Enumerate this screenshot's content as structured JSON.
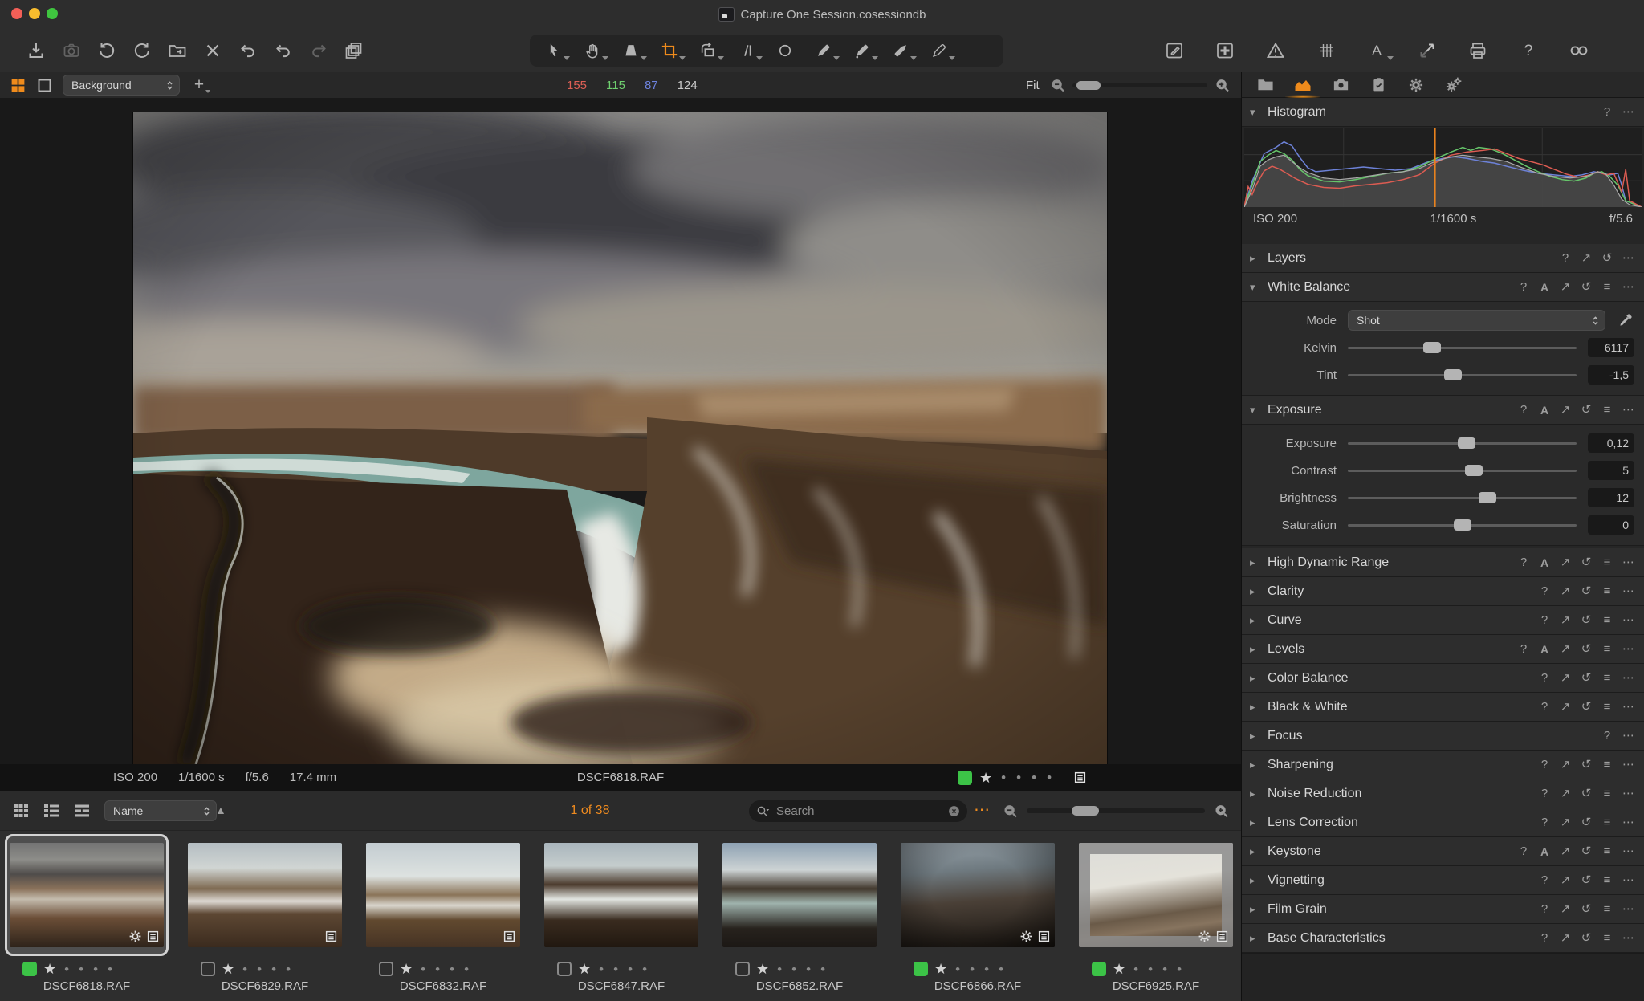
{
  "window": {
    "title": "Capture One Session.cosessiondb"
  },
  "toolbar": {
    "left": [
      {
        "name": "import-button",
        "icon": "import"
      },
      {
        "name": "capture-button",
        "icon": "camera",
        "dim": true,
        "gs": true
      },
      {
        "name": "rotate-ccw-button",
        "icon": "rotate-ccw",
        "gs": true
      },
      {
        "name": "rotate-cw-button",
        "icon": "rotate-cw"
      },
      {
        "name": "move-to-folder-button",
        "icon": "folder-move",
        "gs": true
      },
      {
        "name": "delete-button",
        "icon": "delete-x"
      },
      {
        "name": "revert-button",
        "icon": "undo",
        "gs": true
      },
      {
        "name": "undo-button",
        "icon": "undo",
        "gs": true
      },
      {
        "name": "redo-button",
        "icon": "redo",
        "dim": true
      },
      {
        "name": "clone-variant-button",
        "icon": "stack",
        "gs": true
      }
    ],
    "cursor_tools": [
      {
        "name": "select-tool",
        "icon": "select",
        "caret": true
      },
      {
        "name": "pan-tool",
        "icon": "hand",
        "caret": true
      },
      {
        "name": "loupe-tool",
        "icon": "loupe",
        "caret": true
      },
      {
        "name": "crop-tool",
        "icon": "crop",
        "caret": true,
        "active": true
      },
      {
        "name": "rotation-tool",
        "icon": "rotation",
        "caret": true
      },
      {
        "name": "straighten-tool",
        "icon": "straighten",
        "caret": true
      },
      {
        "name": "spot-tool",
        "icon": "spot"
      },
      {
        "name": "heal-brush-tool",
        "icon": "pen-draw",
        "caret": true
      },
      {
        "name": "clone-brush-tool",
        "icon": "pen-fill",
        "caret": true
      },
      {
        "name": "erase-brush-tool",
        "icon": "pen-erase",
        "caret": true
      },
      {
        "name": "color-picker-tool",
        "icon": "pen-pick",
        "caret": true
      }
    ],
    "right": [
      {
        "name": "edit-recipe-button",
        "icon": "edit-box"
      },
      {
        "name": "batch-grid-button",
        "icon": "grid-box"
      },
      {
        "name": "exposure-warning-button",
        "icon": "warning"
      },
      {
        "name": "grid-overlay-button",
        "icon": "grid"
      },
      {
        "name": "annotations-button",
        "icon": "annotate",
        "caret": true
      },
      {
        "name": "copy-apply-adjustments-button",
        "icon": "copy-arrows"
      },
      {
        "name": "print-button",
        "icon": "print"
      },
      {
        "name": "help-button",
        "icon": "help"
      },
      {
        "name": "proof-view-button",
        "icon": "proof"
      }
    ]
  },
  "viewer_toolbar": {
    "layout_select": "Background",
    "rgb": {
      "r": "155",
      "g": "115",
      "b": "87",
      "l": "124"
    },
    "zoom_label": "Fit",
    "zoom_percent": 3
  },
  "tool_tabs": [
    {
      "name": "tab-library",
      "icon": "tab-folder"
    },
    {
      "name": "tab-exposure",
      "icon": "tab-histogram",
      "active": true
    },
    {
      "name": "tab-capture",
      "icon": "tab-camera"
    },
    {
      "name": "tab-metadata",
      "icon": "tab-clipboard"
    },
    {
      "name": "tab-settings",
      "icon": "tab-gear"
    },
    {
      "name": "tab-batch",
      "icon": "tab-gears"
    }
  ],
  "histogram": {
    "title": "Histogram",
    "icons": [
      "help",
      "more"
    ],
    "iso": "ISO 200",
    "shutter": "1/1600 s",
    "aperture": "f/5.6",
    "cursor_percent": 48,
    "colors": {
      "red": "#dd5c52",
      "green": "#66c56a",
      "blue": "#6d82d8",
      "luma": "#a9a9a9",
      "cursor": "#e8821e",
      "fill": "#474747"
    },
    "series": {
      "luma": [
        [
          0,
          0
        ],
        [
          2,
          22
        ],
        [
          4,
          52
        ],
        [
          6,
          60
        ],
        [
          8,
          64
        ],
        [
          10,
          66
        ],
        [
          12,
          58
        ],
        [
          14,
          50
        ],
        [
          16,
          44
        ],
        [
          20,
          37
        ],
        [
          24,
          35
        ],
        [
          28,
          37
        ],
        [
          32,
          40
        ],
        [
          36,
          43
        ],
        [
          40,
          45
        ],
        [
          44,
          49
        ],
        [
          48,
          58
        ],
        [
          52,
          64
        ],
        [
          55,
          66
        ],
        [
          58,
          64
        ],
        [
          62,
          62
        ],
        [
          66,
          58
        ],
        [
          70,
          50
        ],
        [
          74,
          43
        ],
        [
          78,
          39
        ],
        [
          82,
          37
        ],
        [
          86,
          39
        ],
        [
          89,
          45
        ],
        [
          91,
          42
        ],
        [
          93,
          28
        ],
        [
          95,
          10
        ],
        [
          97,
          3
        ],
        [
          100,
          0
        ]
      ],
      "red": [
        [
          0,
          0
        ],
        [
          1,
          26
        ],
        [
          2,
          16
        ],
        [
          3,
          28
        ],
        [
          5,
          46
        ],
        [
          7,
          52
        ],
        [
          9,
          48
        ],
        [
          11,
          42
        ],
        [
          13,
          36
        ],
        [
          16,
          29
        ],
        [
          20,
          25
        ],
        [
          24,
          24
        ],
        [
          28,
          27
        ],
        [
          32,
          29
        ],
        [
          36,
          31
        ],
        [
          40,
          35
        ],
        [
          44,
          41
        ],
        [
          48,
          56
        ],
        [
          52,
          66
        ],
        [
          56,
          70
        ],
        [
          60,
          72
        ],
        [
          63,
          74
        ],
        [
          66,
          68
        ],
        [
          69,
          62
        ],
        [
          72,
          58
        ],
        [
          75,
          54
        ],
        [
          78,
          48
        ],
        [
          81,
          42
        ],
        [
          84,
          38
        ],
        [
          87,
          41
        ],
        [
          89,
          45
        ],
        [
          91,
          41
        ],
        [
          93,
          43
        ],
        [
          95,
          19
        ],
        [
          96,
          48
        ],
        [
          97,
          8
        ],
        [
          100,
          0
        ]
      ],
      "green": [
        [
          0,
          0
        ],
        [
          2,
          28
        ],
        [
          4,
          58
        ],
        [
          6,
          66
        ],
        [
          8,
          72
        ],
        [
          10,
          68
        ],
        [
          12,
          60
        ],
        [
          14,
          48
        ],
        [
          16,
          40
        ],
        [
          20,
          33
        ],
        [
          24,
          32
        ],
        [
          28,
          35
        ],
        [
          32,
          39
        ],
        [
          36,
          43
        ],
        [
          40,
          45
        ],
        [
          44,
          51
        ],
        [
          48,
          61
        ],
        [
          52,
          70
        ],
        [
          55,
          76
        ],
        [
          57,
          72
        ],
        [
          59,
          76
        ],
        [
          62,
          74
        ],
        [
          65,
          68
        ],
        [
          68,
          60
        ],
        [
          71,
          52
        ],
        [
          74,
          45
        ],
        [
          77,
          39
        ],
        [
          80,
          35
        ],
        [
          83,
          33
        ],
        [
          86,
          37
        ],
        [
          88,
          43
        ],
        [
          90,
          45
        ],
        [
          92,
          39
        ],
        [
          94,
          28
        ],
        [
          96,
          8
        ],
        [
          100,
          0
        ]
      ],
      "blue": [
        [
          0,
          0
        ],
        [
          2,
          33
        ],
        [
          5,
          68
        ],
        [
          8,
          76
        ],
        [
          10,
          83
        ],
        [
          12,
          78
        ],
        [
          14,
          63
        ],
        [
          16,
          50
        ],
        [
          18,
          45
        ],
        [
          22,
          47
        ],
        [
          26,
          49
        ],
        [
          30,
          51
        ],
        [
          34,
          49
        ],
        [
          38,
          47
        ],
        [
          42,
          49
        ],
        [
          46,
          57
        ],
        [
          50,
          62
        ],
        [
          53,
          64
        ],
        [
          56,
          62
        ],
        [
          60,
          58
        ],
        [
          63,
          56
        ],
        [
          66,
          52
        ],
        [
          70,
          47
        ],
        [
          74,
          43
        ],
        [
          78,
          41
        ],
        [
          82,
          39
        ],
        [
          85,
          41
        ],
        [
          88,
          45
        ],
        [
          90,
          43
        ],
        [
          92,
          41
        ],
        [
          94,
          43
        ],
        [
          95,
          28
        ],
        [
          96,
          8
        ],
        [
          100,
          0
        ]
      ]
    }
  },
  "layers_panel": [
    {
      "label": "Layers",
      "icons": [
        "help",
        "copy",
        "reset",
        "more"
      ]
    }
  ],
  "white_balance": {
    "title": "White Balance",
    "icons": [
      "help",
      "auto",
      "copy",
      "reset",
      "presets",
      "more"
    ],
    "mode_label": "Mode",
    "mode_value": "Shot",
    "rows": [
      {
        "label": "Kelvin",
        "value": "6117",
        "percent": 37
      },
      {
        "label": "Tint",
        "value": "-1,5",
        "percent": 46
      }
    ]
  },
  "exposure_panel": {
    "title": "Exposure",
    "icons": [
      "help",
      "auto",
      "copy",
      "reset",
      "presets",
      "more"
    ],
    "rows": [
      {
        "label": "Exposure",
        "value": "0,12",
        "percent": 52
      },
      {
        "label": "Contrast",
        "value": "5",
        "percent": 55
      },
      {
        "label": "Brightness",
        "value": "12",
        "percent": 61
      },
      {
        "label": "Saturation",
        "value": "0",
        "percent": 50
      }
    ]
  },
  "panels": [
    {
      "label": "High Dynamic Range",
      "icons": [
        "help",
        "auto",
        "copy",
        "reset",
        "presets",
        "more"
      ]
    },
    {
      "label": "Clarity",
      "icons": [
        "help",
        "copy",
        "reset",
        "presets",
        "more"
      ]
    },
    {
      "label": "Curve",
      "icons": [
        "help",
        "copy",
        "reset",
        "presets",
        "more"
      ]
    },
    {
      "label": "Levels",
      "icons": [
        "help",
        "auto",
        "copy",
        "reset",
        "presets",
        "more"
      ]
    },
    {
      "label": "Color Balance",
      "icons": [
        "help",
        "copy",
        "reset",
        "presets",
        "more"
      ]
    },
    {
      "label": "Black & White",
      "icons": [
        "help",
        "copy",
        "reset",
        "presets",
        "more"
      ]
    },
    {
      "label": "Focus",
      "icons": [
        "help",
        "more"
      ]
    },
    {
      "label": "Sharpening",
      "icons": [
        "help",
        "copy",
        "reset",
        "presets",
        "more"
      ]
    },
    {
      "label": "Noise Reduction",
      "icons": [
        "help",
        "copy",
        "reset",
        "presets",
        "more"
      ]
    },
    {
      "label": "Lens Correction",
      "icons": [
        "help",
        "copy",
        "reset",
        "presets",
        "more"
      ]
    },
    {
      "label": "Keystone",
      "icons": [
        "help",
        "auto",
        "copy",
        "reset",
        "presets",
        "more"
      ]
    },
    {
      "label": "Vignetting",
      "icons": [
        "help",
        "copy",
        "reset",
        "presets",
        "more"
      ]
    },
    {
      "label": "Film Grain",
      "icons": [
        "help",
        "copy",
        "reset",
        "presets",
        "more"
      ]
    },
    {
      "label": "Base Characteristics",
      "icons": [
        "help",
        "copy",
        "reset",
        "presets",
        "more"
      ]
    }
  ],
  "viewer_info": {
    "exif": [
      {
        "v": "ISO 200"
      },
      {
        "v": "1/1600 s"
      },
      {
        "v": "f/5.6"
      },
      {
        "v": "17.4 mm"
      }
    ],
    "filename": "DSCF6818.RAF",
    "rating": 1,
    "tag_color": "green"
  },
  "browser": {
    "sort_label": "Name",
    "count": "1 of 38",
    "search_placeholder": "Search",
    "zoom_percent": 25
  },
  "filmstrip": [
    {
      "filename": "DSCF6818.RAF",
      "x": 3,
      "tag": "tag-green",
      "cls": "t1",
      "selected": true,
      "badges": [
        "badge-gear",
        "badge-note"
      ],
      "rating": 1
    },
    {
      "filename": "DSCF6829.RAF",
      "x": 225,
      "tag": "tag-none",
      "cls": "t2",
      "badges": [
        "badge-note"
      ],
      "rating": 1
    },
    {
      "filename": "DSCF6832.RAF",
      "x": 447,
      "tag": "tag-none",
      "cls": "t3",
      "badges": [
        "badge-note"
      ],
      "rating": 1
    },
    {
      "filename": "DSCF6847.RAF",
      "x": 669,
      "tag": "tag-none",
      "cls": "t4",
      "badges": [],
      "rating": 1
    },
    {
      "filename": "DSCF6852.RAF",
      "x": 891,
      "tag": "tag-none",
      "cls": "t5",
      "badges": [],
      "rating": 1
    },
    {
      "filename": "DSCF6866.RAF",
      "x": 1113,
      "tag": "tag-green",
      "cls": "t6",
      "badges": [
        "badge-gear",
        "badge-note"
      ],
      "rating": 1
    },
    {
      "filename": "DSCF6925.RAF",
      "x": 1335,
      "tag": "tag-green",
      "cls": "t7",
      "badges": [
        "badge-gear",
        "badge-note"
      ],
      "rating": 1
    }
  ],
  "accent_colors": {
    "orange": "#ef8b1c",
    "tag_green": "#3cc347"
  }
}
